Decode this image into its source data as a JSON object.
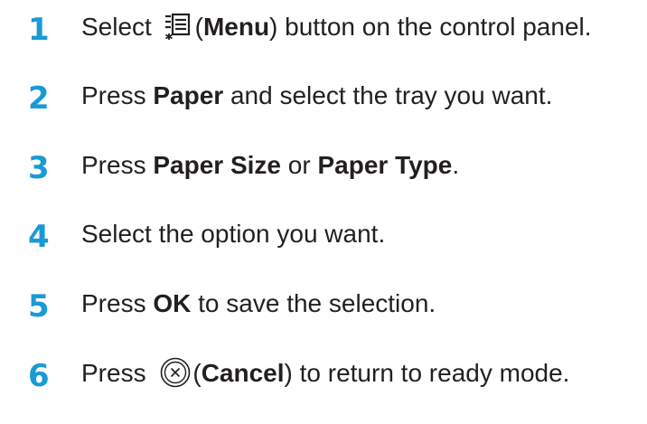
{
  "steps": [
    {
      "number": "1",
      "pre": "Select ",
      "icon": "menu-icon",
      "open_paren": "(",
      "bold": "Menu",
      "post": ") button on the control panel."
    },
    {
      "number": "2",
      "pre": "Press ",
      "bold": "Paper",
      "post": " and select the tray you want."
    },
    {
      "number": "3",
      "pre": "Press ",
      "bold": "Paper Size",
      "mid": " or ",
      "bold2": "Paper Type",
      "post": "."
    },
    {
      "number": "4",
      "text": "Select the option you want."
    },
    {
      "number": "5",
      "pre": "Press ",
      "bold": "OK",
      "post": " to save the selection."
    },
    {
      "number": "6",
      "pre": "Press ",
      "icon": "cancel-icon",
      "open_paren": "(",
      "bold": "Cancel",
      "post": ") to return to ready mode."
    }
  ],
  "colors": {
    "step_number": "#1a9ad6",
    "text": "#231f20"
  }
}
